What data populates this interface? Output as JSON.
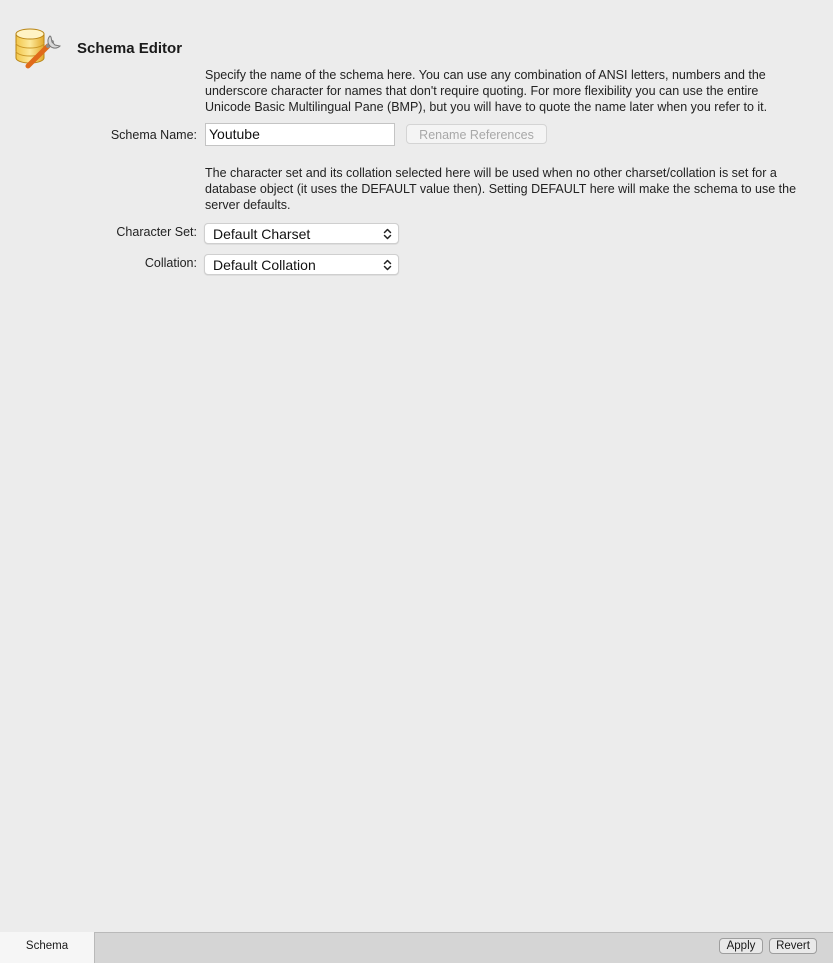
{
  "header": {
    "title": "Schema Editor",
    "icon": "database-wrench-icon"
  },
  "schema_name": {
    "description_lines": [
      "Specify the name of the schema here. You can use any combination of ANSI letters, numbers and the",
      "underscore character for names that don't require quoting. For more flexibility you can use the entire",
      "Unicode Basic Multilingual Pane (BMP), but you will have to quote the name later when you refer to it."
    ],
    "label": "Schema Name:",
    "value": "Youtube",
    "rename_button": "Rename References"
  },
  "charset": {
    "description_lines": [
      "The character set and its collation selected here will be used when no other charset/collation is set for a",
      "database object (it uses the DEFAULT value then). Setting DEFAULT here will make the schema to use the",
      "server defaults."
    ],
    "character_set_label": "Character Set:",
    "character_set_value": "Default Charset",
    "collation_label": "Collation:",
    "collation_value": "Default Collation"
  },
  "bottom_bar": {
    "tab_label": "Schema",
    "apply_label": "Apply",
    "revert_label": "Revert"
  }
}
